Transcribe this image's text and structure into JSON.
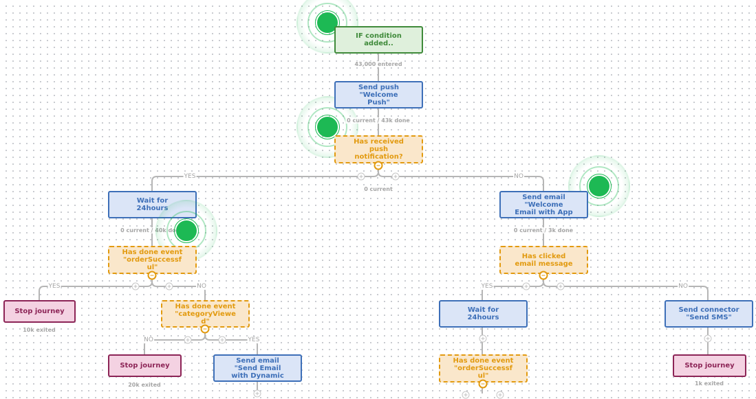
{
  "colors": {
    "trigger": "#3f8a3a",
    "action": "#3d6fb8",
    "condition": "#e29a0f",
    "stop": "#8c2456",
    "live_indicator": "#1db954",
    "connector": "#b5b5b5"
  },
  "nodes": {
    "trigger": {
      "type": "trigger",
      "label": "IF condition\nadded.."
    },
    "send_push": {
      "type": "action",
      "label": "Send push\n\"Welcome\nPush\""
    },
    "has_received_push": {
      "type": "condition",
      "label": "Has received\npush\nnotification?"
    },
    "wait_left": {
      "type": "action",
      "label": "Wait for\n24hours"
    },
    "has_done_order_left": {
      "type": "condition",
      "label": "Has done event\n\"orderSuccessf\nul\""
    },
    "stop_left": {
      "type": "stop",
      "label": "Stop journey"
    },
    "has_done_category": {
      "type": "condition",
      "label": "Has done event\n\"categoryViewe\nd\""
    },
    "stop_mid": {
      "type": "stop",
      "label": "Stop journey"
    },
    "send_email_dynamic": {
      "type": "action",
      "label": "Send email\n\"Send Email\nwith Dynamic"
    },
    "send_email_welcome": {
      "type": "action",
      "label": "Send email\n\"Welcome\nEmail with App"
    },
    "has_clicked_email": {
      "type": "condition",
      "label": "Has clicked\nemail message"
    },
    "wait_right": {
      "type": "action",
      "label": "Wait for\n24hours"
    },
    "has_done_order_right": {
      "type": "condition",
      "label": "Has done event\n\"orderSuccessf\nul\""
    },
    "send_connector_sms": {
      "type": "action",
      "label": "Send connector\n\"Send SMS\""
    },
    "stop_right": {
      "type": "stop",
      "label": "Stop journey"
    }
  },
  "stats": {
    "trigger_entered": "43,000 entered",
    "send_push": "0 current / 43k done",
    "has_received_push": "0 current",
    "wait_left": "0 current / 40k done",
    "send_email_welcome": "0 current / 3k done",
    "stop_left": "10k exited",
    "stop_mid": "20k exited",
    "stop_right": "1k exited"
  },
  "branch_labels": {
    "yes": "YES",
    "no": "NO"
  },
  "live_indicators": [
    "trigger",
    "has_received_push",
    "has_done_order_left",
    "send_email_welcome"
  ]
}
